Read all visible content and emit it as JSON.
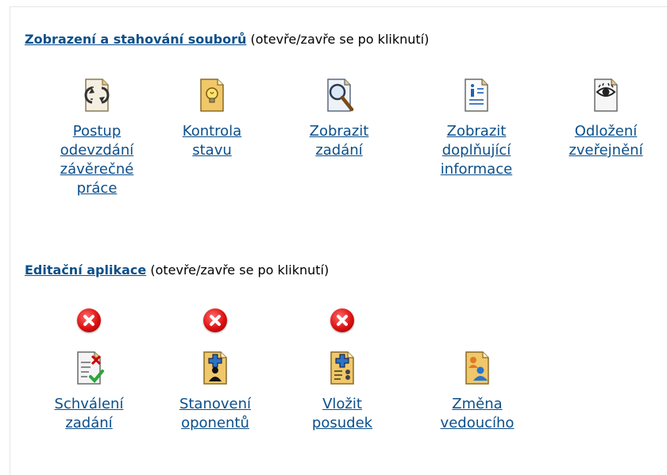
{
  "section_files": {
    "title_link": "Zobrazení a stahování souborů",
    "hint": "(otevře/zavře se po kliknutí)",
    "items": [
      {
        "icon": "document-cycle-icon",
        "lines": [
          "Postup",
          "odevzdání",
          "závěrečné",
          "práce"
        ]
      },
      {
        "icon": "document-lightbulb-icon",
        "lines": [
          "Kontrola",
          "stavu"
        ]
      },
      {
        "icon": "document-magnifier-icon",
        "lines": [
          "Zobrazit",
          "zadání"
        ]
      },
      {
        "icon": "document-info-icon",
        "lines": [
          "Zobrazit",
          "doplňující",
          "informace"
        ]
      },
      {
        "icon": "document-eye-icon",
        "lines": [
          "Odložení",
          "zveřejnění"
        ]
      }
    ]
  },
  "section_edit": {
    "title_link": "Editační aplikace",
    "hint": "(otevře/zavře se po kliknutí)",
    "items": [
      {
        "icon": "document-check-icon",
        "error": true,
        "lines": [
          "Schválení",
          "zadání"
        ]
      },
      {
        "icon": "document-person-add-icon",
        "error": true,
        "lines": [
          "Stanovení",
          "oponentů"
        ]
      },
      {
        "icon": "document-review-add-icon",
        "error": true,
        "lines": [
          "Vložit",
          "posudek"
        ]
      },
      {
        "icon": "document-person-change-icon",
        "error": false,
        "lines": [
          "Změna",
          "vedoucího"
        ]
      }
    ]
  },
  "colors": {
    "link": "#0b4f8a",
    "error": "#d11111"
  }
}
